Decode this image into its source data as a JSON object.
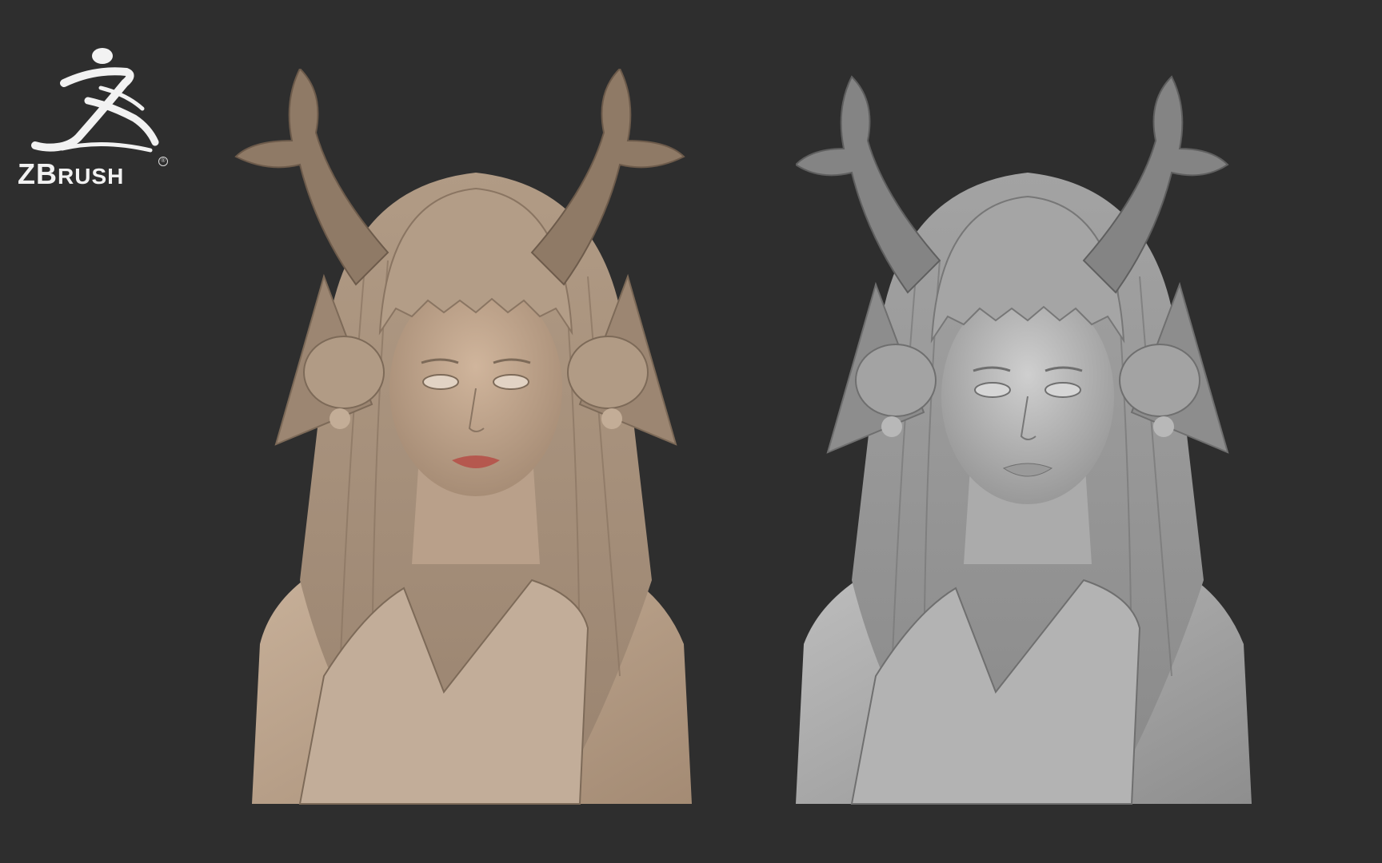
{
  "logo": {
    "text_big_z": "Z",
    "text_big_b": "B",
    "text_small": "RUSH",
    "registered": "®",
    "icon": "zbrush-figure-icon"
  },
  "colors": {
    "background": "#2e2e2e",
    "clay_tan": "#b6a08a",
    "clay_tan_dark": "#7d6a58",
    "clay_gray": "#a9a9a9",
    "clay_gray_dark": "#6f6f6f",
    "lips": "#b5584e"
  },
  "renders": [
    {
      "material": "skin-shade"
    },
    {
      "material": "matcap-gray"
    }
  ]
}
